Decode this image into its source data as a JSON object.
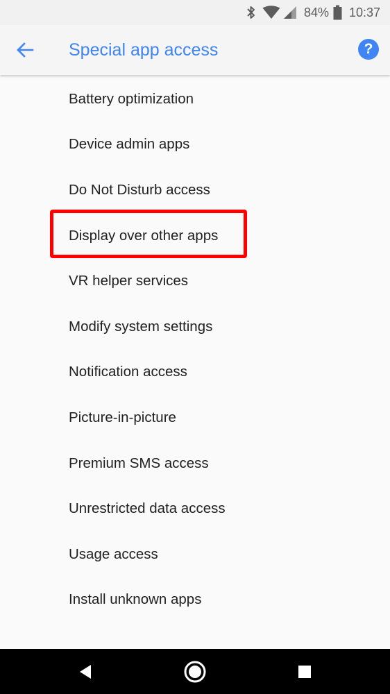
{
  "status_bar": {
    "battery_percent": "84%",
    "time": "10:37",
    "icons": [
      "bluetooth-icon",
      "wifi-icon",
      "cellular-icon",
      "battery-icon"
    ]
  },
  "toolbar": {
    "title": "Special app access",
    "back_icon": "arrow-left-icon",
    "help_icon": "help-icon",
    "help_glyph": "?"
  },
  "list": {
    "items": [
      {
        "label": "Battery optimization"
      },
      {
        "label": "Device admin apps"
      },
      {
        "label": "Do Not Disturb access"
      },
      {
        "label": "Display over other apps",
        "highlighted": true
      },
      {
        "label": "VR helper services"
      },
      {
        "label": "Modify system settings"
      },
      {
        "label": "Notification access"
      },
      {
        "label": "Picture-in-picture"
      },
      {
        "label": "Premium SMS access"
      },
      {
        "label": "Unrestricted data access"
      },
      {
        "label": "Usage access"
      },
      {
        "label": "Install unknown apps"
      }
    ]
  },
  "nav_bar": {
    "buttons": [
      "back-triangle-icon",
      "home-circle-icon",
      "recents-square-icon"
    ]
  },
  "colors": {
    "accent": "#3f85f4",
    "highlight": "#ff0000",
    "text_primary": "#212121",
    "nav_background": "#000000"
  }
}
